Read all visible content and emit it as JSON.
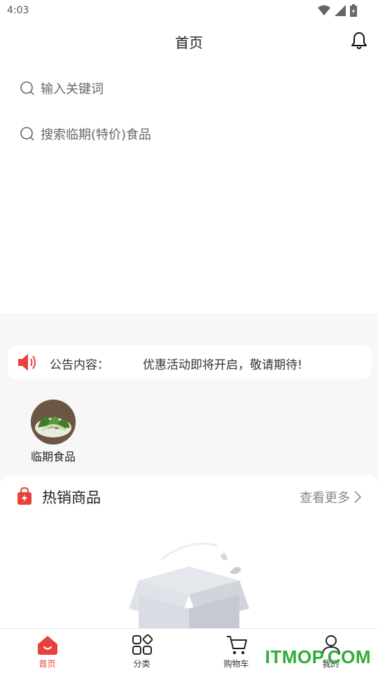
{
  "status_bar": {
    "time": "4:03"
  },
  "header": {
    "title": "首页"
  },
  "search": {
    "placeholder_1": "输入关键词",
    "placeholder_2": "搜索临期(特价)食品"
  },
  "notice": {
    "label": "公告内容：",
    "text": "优惠活动即将开启，敬请期待!"
  },
  "categories": [
    {
      "label": "临期食品"
    }
  ],
  "hot_section": {
    "title": "热销商品",
    "more": "查看更多"
  },
  "tabbar": {
    "items": [
      {
        "label": "首页",
        "active": true
      },
      {
        "label": "分类",
        "active": false
      },
      {
        "label": "购物车",
        "active": false
      },
      {
        "label": "我的",
        "active": false
      }
    ]
  },
  "watermark": "ITMOP.COM",
  "colors": {
    "accent": "#e8403b",
    "watermark": "#2fae37"
  }
}
